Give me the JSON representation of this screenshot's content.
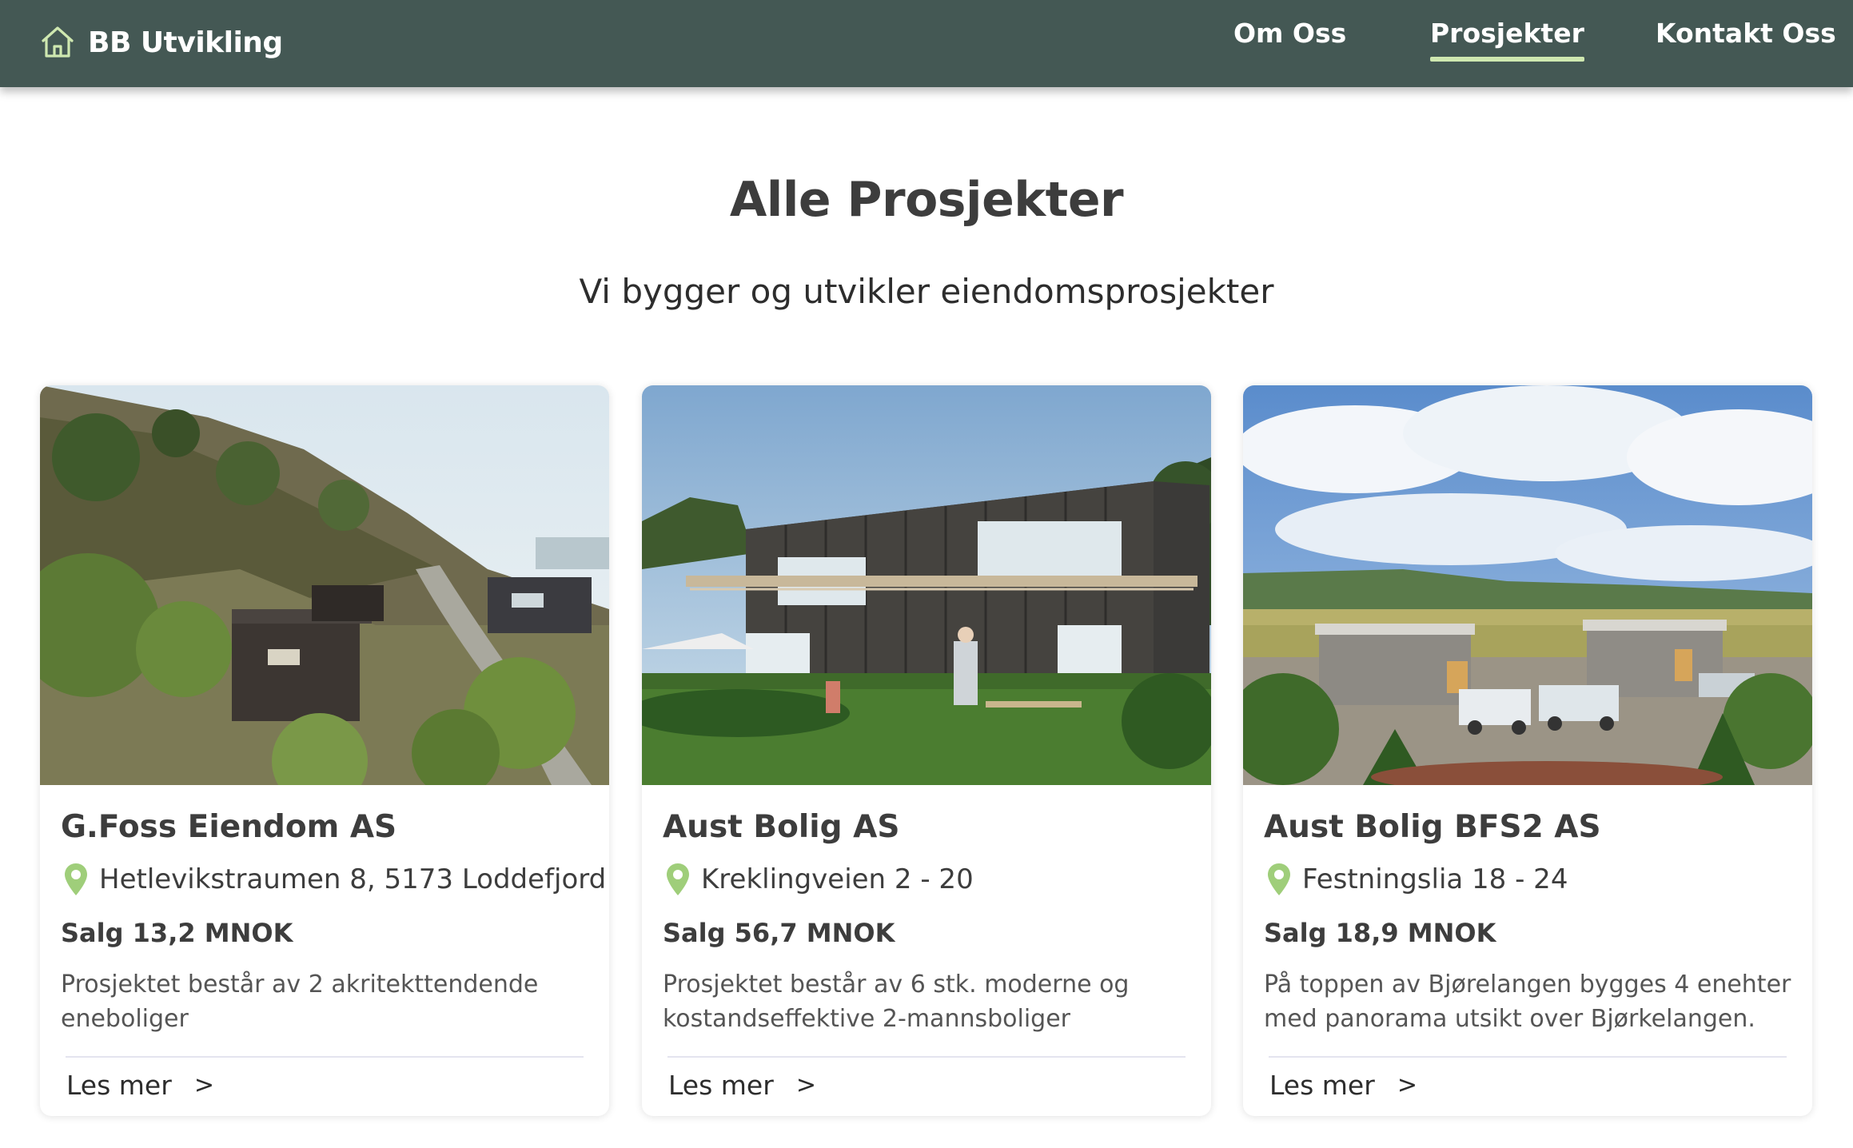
{
  "header": {
    "brand": "BB Utvikling",
    "logo_icon": "house-icon",
    "nav": [
      {
        "label": "Om Oss",
        "active": false
      },
      {
        "label": "Prosjekter",
        "active": true
      },
      {
        "label": "Kontakt Oss",
        "active": false
      }
    ]
  },
  "main": {
    "title": "Alle Prosjekter",
    "subtitle": "Vi bygger og utvikler eiendomsprosjekter"
  },
  "projects": [
    {
      "name": "G.Foss Eiendom AS",
      "address": "Hetlevikstraumen 8, 5173 Loddefjord",
      "sale": "Salg 13,2 MNOK",
      "description": "Prosjektet består av 2 akritekttendende eneboliger",
      "link_label": "Les mer",
      "link_icon": ">"
    },
    {
      "name": "Aust Bolig AS",
      "address": "Kreklingveien 2 - 20",
      "sale": "Salg 56,7 MNOK",
      "description": "Prosjektet består av 6 stk. moderne og kostandseffektive 2-mannsboliger",
      "link_label": "Les mer",
      "link_icon": ">"
    },
    {
      "name": "Aust Bolig BFS2 AS",
      "address": "Festningslia 18 - 24",
      "sale": "Salg 18,9 MNOK",
      "description": "På toppen av Bjørelangen bygges 4 enehter med panorama utsikt over Bjørkelangen.",
      "link_label": "Les mer",
      "link_icon": ">"
    }
  ],
  "colors": {
    "header_bg": "#445854",
    "active_underline": "#cfe8b0",
    "pin": "#9fce7a",
    "text": "#3d3d3d"
  }
}
